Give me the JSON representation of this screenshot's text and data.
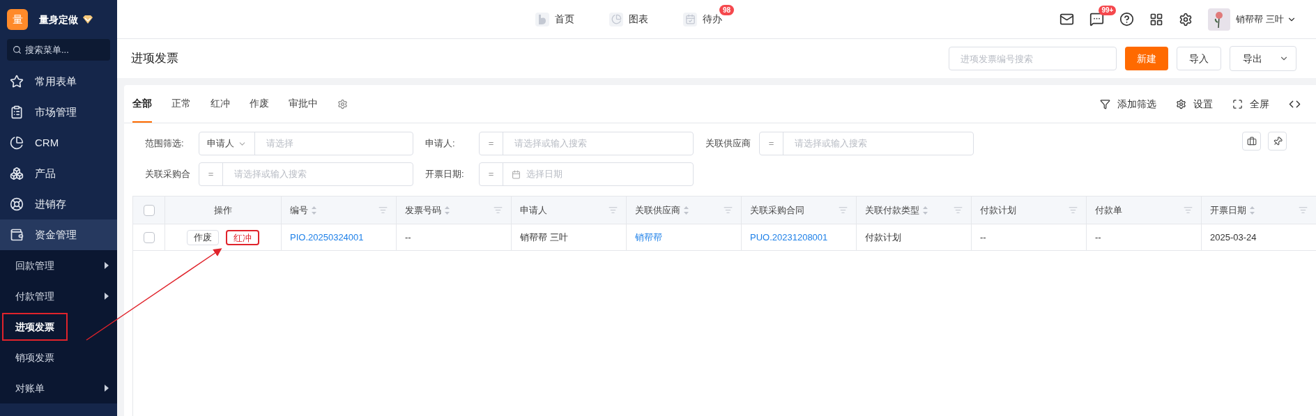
{
  "brand": {
    "logo": "量",
    "name": "量身定做"
  },
  "sidebar": {
    "search_placeholder": "搜索菜单...",
    "items": [
      {
        "label": "常用表单",
        "expanded": false
      },
      {
        "label": "市场管理",
        "expanded": false
      },
      {
        "label": "CRM",
        "expanded": false
      },
      {
        "label": "产品",
        "expanded": false
      },
      {
        "label": "进销存",
        "expanded": false
      },
      {
        "label": "资金管理",
        "expanded": true,
        "children": [
          {
            "label": "回款管理",
            "has_submenu": true,
            "selected": false,
            "annotated": false
          },
          {
            "label": "付款管理",
            "has_submenu": true,
            "selected": false,
            "annotated": false
          },
          {
            "label": "进项发票",
            "has_submenu": false,
            "selected": true,
            "annotated": true
          },
          {
            "label": "销项发票",
            "has_submenu": false,
            "selected": false,
            "annotated": false
          },
          {
            "label": "对账单",
            "has_submenu": true,
            "selected": false,
            "annotated": false
          }
        ]
      }
    ]
  },
  "top_nav": [
    {
      "label": "首页"
    },
    {
      "label": "图表"
    },
    {
      "label": "待办",
      "badge": "98"
    }
  ],
  "header": {
    "message_badge": "99+",
    "user": "销帮帮 三叶"
  },
  "page": {
    "title": "进项发票",
    "search_placeholder": "进项发票编号搜索",
    "buttons": [
      {
        "label": "新建",
        "kind": "primary"
      },
      {
        "label": "导入",
        "kind": "plain"
      },
      {
        "label": "导出",
        "kind": "dropdown"
      }
    ]
  },
  "tabs": [
    {
      "label": "全部",
      "selected": true
    },
    {
      "label": "正常",
      "selected": false
    },
    {
      "label": "红冲",
      "selected": false
    },
    {
      "label": "作废",
      "selected": false
    },
    {
      "label": "审批中",
      "selected": false
    }
  ],
  "toolbar": [
    "添加筛选",
    "设置",
    "全屏"
  ],
  "filters": [
    {
      "label": "范围筛选:",
      "kind": "select",
      "operator": "申请人",
      "placeholder": "请选择"
    },
    {
      "label": "申请人:",
      "kind": "equals",
      "operator": "=",
      "placeholder": "请选择或输入搜索"
    },
    {
      "label": "关联供应商",
      "kind": "equals",
      "operator": "=",
      "placeholder": "请选择或输入搜索"
    },
    {
      "label": "关联采购合",
      "kind": "equals",
      "operator": "=",
      "placeholder": "请选择或输入搜索"
    },
    {
      "label": "开票日期:",
      "kind": "date",
      "operator": "=",
      "placeholder": "选择日期"
    }
  ],
  "table": {
    "select_all_checked": false,
    "columns": [
      {
        "label": "操作",
        "sortable": false,
        "filterable": false
      },
      {
        "label": "编号",
        "sortable": true,
        "filterable": true
      },
      {
        "label": "发票号码",
        "sortable": true,
        "filterable": true
      },
      {
        "label": "申请人",
        "sortable": false,
        "filterable": true
      },
      {
        "label": "关联供应商",
        "sortable": true,
        "filterable": true
      },
      {
        "label": "关联采购合同",
        "sortable": false,
        "filterable": true
      },
      {
        "label": "关联付款类型",
        "sortable": true,
        "filterable": true
      },
      {
        "label": "付款计划",
        "sortable": false,
        "filterable": true
      },
      {
        "label": "付款单",
        "sortable": false,
        "filterable": true
      },
      {
        "label": "开票日期",
        "sortable": true,
        "filterable": true
      }
    ],
    "rows": [
      {
        "checked": false,
        "cells": [
          {
            "kind": "actions",
            "actions": [
              {
                "label": "作废",
                "annotated": false
              },
              {
                "label": "红冲",
                "annotated": true
              }
            ]
          },
          {
            "text": "PIO.20250324001",
            "kind": "link"
          },
          {
            "text": "--",
            "kind": "text"
          },
          {
            "text": "销帮帮 三叶",
            "kind": "text"
          },
          {
            "text": "销帮帮",
            "kind": "link"
          },
          {
            "text": "PUO.20231208001",
            "kind": "link"
          },
          {
            "text": "付款计划",
            "kind": "text"
          },
          {
            "text": "--",
            "kind": "text"
          },
          {
            "text": "--",
            "kind": "text"
          },
          {
            "text": "2025-03-24",
            "kind": "text"
          }
        ]
      }
    ]
  }
}
